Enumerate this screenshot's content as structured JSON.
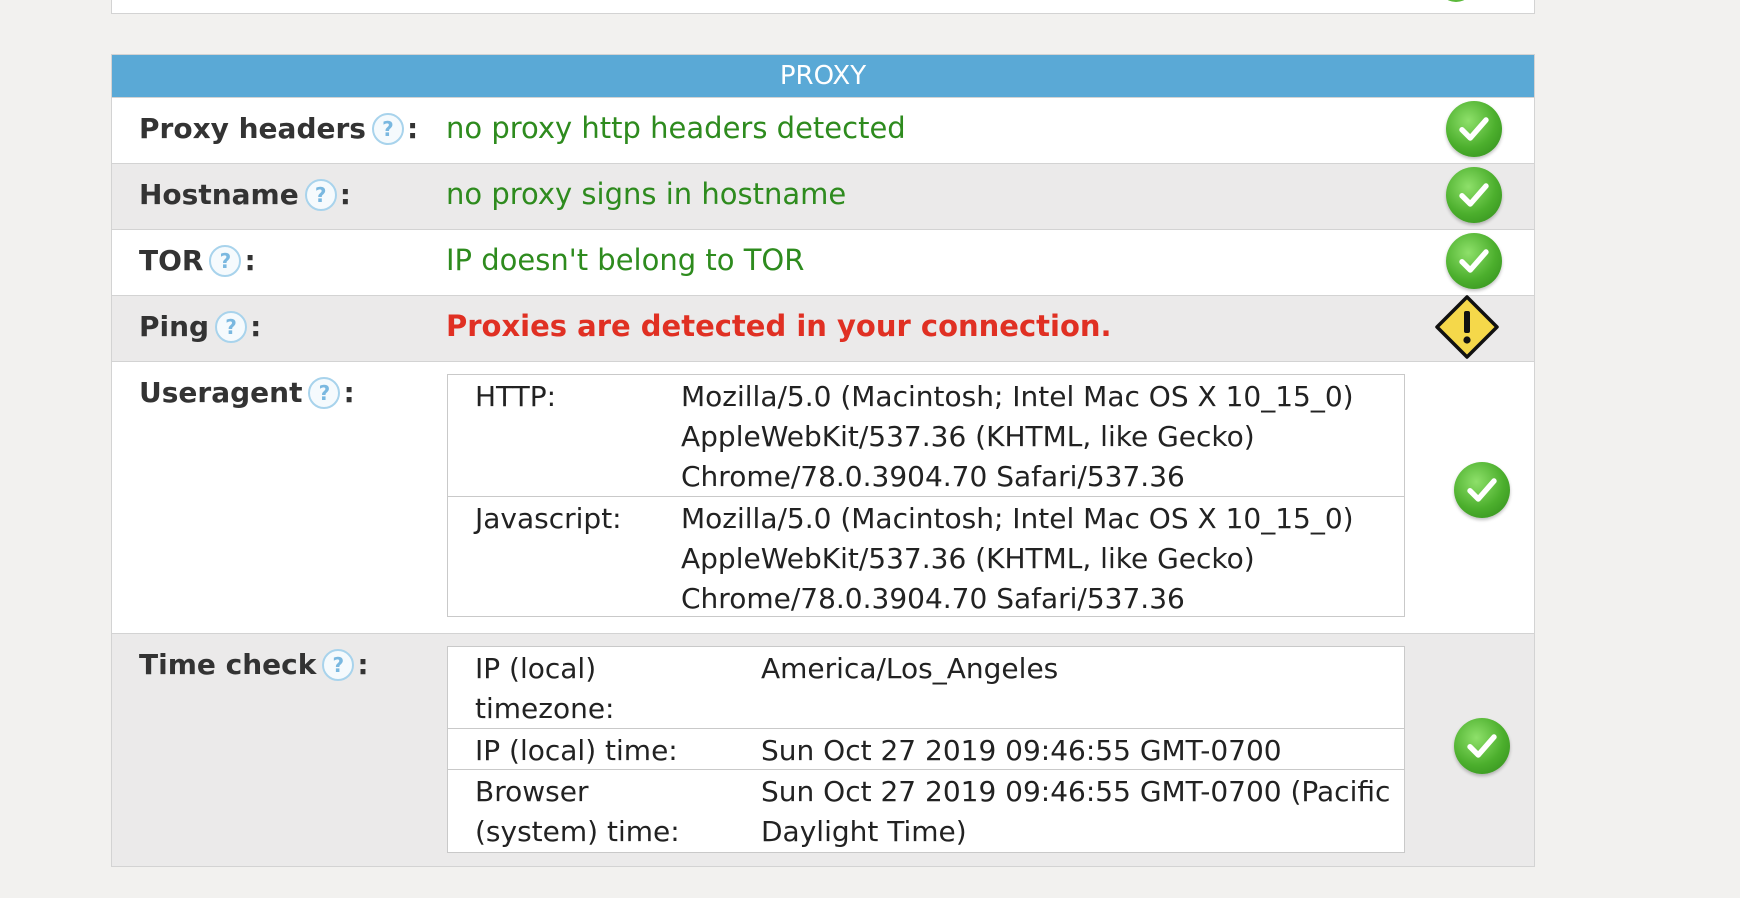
{
  "panel": {
    "title": "PROXY"
  },
  "rows": {
    "proxy_headers": {
      "label": "Proxy headers",
      "help": "?",
      "colon": ":",
      "value": "no proxy http headers detected",
      "status": "ok"
    },
    "hostname": {
      "label": "Hostname",
      "help": "?",
      "colon": ":",
      "value": "no proxy signs in hostname",
      "status": "ok"
    },
    "tor": {
      "label": "TOR",
      "help": "?",
      "colon": ":",
      "value": "IP doesn't belong to TOR",
      "status": "ok"
    },
    "ping": {
      "label": "Ping",
      "help": "?",
      "colon": ":",
      "value": "Proxies are detected in your connection.",
      "status": "warning"
    },
    "useragent": {
      "label": "Useragent",
      "help": "?",
      "colon": ":",
      "status": "ok",
      "entries": [
        {
          "key": "HTTP:",
          "lines": [
            "Mozilla/5.0 (Macintosh; Intel Mac OS X 10_15_0)",
            "AppleWebKit/537.36 (KHTML, like Gecko)",
            "Chrome/78.0.3904.70 Safari/537.36"
          ]
        },
        {
          "key": "Javascript:",
          "lines": [
            "Mozilla/5.0 (Macintosh; Intel Mac OS X 10_15_0)",
            "AppleWebKit/537.36 (KHTML, like Gecko)",
            "Chrome/78.0.3904.70 Safari/537.36"
          ]
        }
      ]
    },
    "time_check": {
      "label": "Time check",
      "help": "?",
      "colon": ":",
      "status": "ok",
      "entries": [
        {
          "key_lines": [
            "IP (local)",
            "timezone:"
          ],
          "value_lines": [
            "America/Los_Angeles"
          ]
        },
        {
          "key_lines": [
            "IP (local) time:"
          ],
          "value_lines": [
            "Sun Oct 27 2019 09:46:55 GMT-0700"
          ]
        },
        {
          "key_lines": [
            "Browser",
            "(system) time:"
          ],
          "value_lines": [
            "Sun Oct 27 2019 09:46:55 GMT-0700 (Pacific",
            "Daylight Time)"
          ]
        }
      ]
    }
  },
  "colors": {
    "header": "#5aa9d6",
    "ok_text": "#2e8b1e",
    "warn_text": "#e03023",
    "ok_icon": "#4caf2d",
    "warn_icon": "#f5d84a"
  },
  "icons": {
    "ok": "check-circle-icon",
    "warning": "warning-diamond-icon",
    "help": "help-question-icon"
  }
}
